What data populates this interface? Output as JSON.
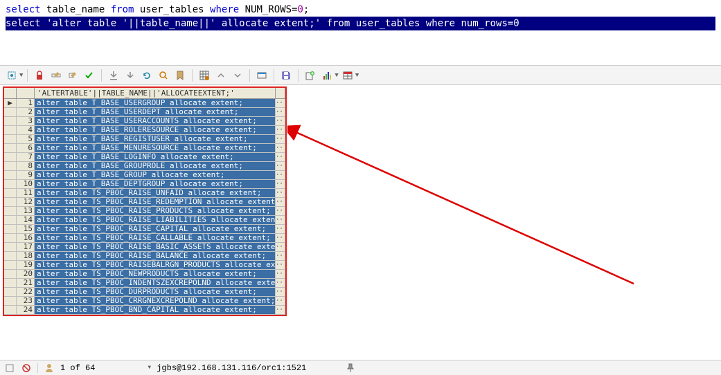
{
  "sql": {
    "line1_parts": [
      "select",
      " table_name ",
      "from",
      " user_tables ",
      "where",
      " NUM_ROWS=",
      "0",
      ";"
    ],
    "line2": "select 'alter table '||table_name||' allocate extent;' from user_tables where num_rows=0"
  },
  "toolbar": {
    "icons": [
      "target",
      "lock",
      "edit-row",
      "edit-cell",
      "check",
      "arrow-down-all",
      "arrow-down",
      "undo",
      "search",
      "bookmark",
      "grid-view",
      "up",
      "down",
      "single-row",
      "save",
      "export",
      "chart",
      "table"
    ]
  },
  "grid": {
    "header": "'ALTERTABLE'||TABLE_NAME||'ALLOCATEEXTENT;'",
    "rows": [
      "alter table T_BASE_USERGROUP allocate extent;",
      "alter table T_BASE_USERDEPT allocate extent;",
      "alter table T_BASE_USERACCOUNTS allocate extent;",
      "alter table T_BASE_ROLERESOURCE allocate extent;",
      "alter table T_BASE_REGISTUSER allocate extent;",
      "alter table T_BASE_MENURESOURCE allocate extent;",
      "alter table T_BASE_LOGINFO allocate extent;",
      "alter table T_BASE_GROUPROLE allocate extent;",
      "alter table T_BASE_GROUP allocate extent;",
      "alter table T_BASE_DEPTGROUP allocate extent;",
      "alter table TS_PBOC_RAISE_UNFAID allocate extent;",
      "alter table TS_PBOC_RAISE_REDEMPTION allocate extent;",
      "alter table TS_PBOC_RAISE_PRODUCTS allocate extent;",
      "alter table TS_PBOC_RAISE_LIABILITIES allocate extent;",
      "alter table TS_PBOC_RAISE_CAPITAL allocate extent;",
      "alter table TS_PBOC_RAISE_CALLABLE allocate extent;",
      "alter table TS_PBOC_RAISE_BASIC_ASSETS allocate extent;",
      "alter table TS_PBOC_RAISE_BALANCE allocate extent;",
      "alter table TS_PBOC_RAISEBALRGN_PRODUCTS allocate extent;",
      "alter table TS_PBOC_NEWPRODUCTS allocate extent;",
      "alter table TS_PBOC_INDENTSZEXCREPOLND allocate extent;",
      "alter table TS_PBOC_DURPRODUCTS allocate extent;",
      "alter table TS_PBOC_CRRGNEXCREPOLND allocate extent;",
      "alter table TS_PBOC_BND_CAPITAL allocate extent;"
    ],
    "current_row_marker": "▶",
    "cell_button": "···"
  },
  "statusbar": {
    "position": "1 of 64",
    "connection": "jgbs@192.168.131.116/orc1:1521"
  }
}
